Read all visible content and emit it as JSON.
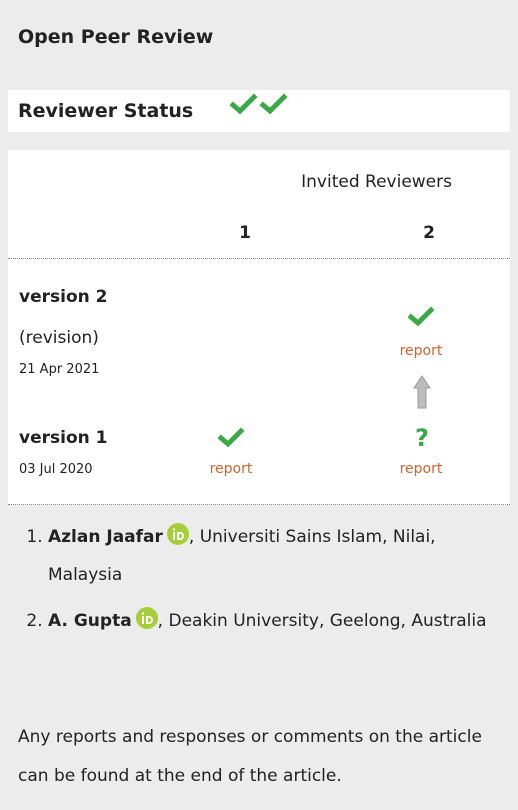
{
  "section_title": "Open Peer Review",
  "reviewer_status": {
    "label": "Reviewer Status",
    "icons": [
      "check-icon",
      "check-icon"
    ]
  },
  "table": {
    "invited_label": "Invited Reviewers",
    "columns": [
      "1",
      "2"
    ],
    "versions": [
      {
        "title": "version 2",
        "subtitle": "(revision)",
        "date": "21 Apr 2021",
        "cells": [
          null,
          {
            "status": "approved",
            "icon": "check-icon",
            "link": "report"
          }
        ]
      },
      {
        "title": "version 1",
        "subtitle": "",
        "date": "03 Jul 2020",
        "cells": [
          {
            "status": "approved",
            "icon": "check-icon",
            "link": "report"
          },
          {
            "status": "approved-with-reservations",
            "icon": "question-icon",
            "link": "report"
          }
        ]
      }
    ]
  },
  "reviewers": [
    {
      "name": "Azlan Jaafar",
      "affiliation": ", Universiti Sains Islam, Nilai, Malaysia",
      "orcid": "orcid-icon"
    },
    {
      "name": "A. Gupta",
      "affiliation": ", Deakin University, Geelong, Australia",
      "orcid": "orcid-icon"
    }
  ],
  "footer_text": "Any reports and responses or comments on the article can be found at the end of the article.",
  "colors": {
    "check": "#3aa845",
    "link": "#d0622a",
    "orcid": "#a6ce39",
    "background": "#ececec"
  }
}
